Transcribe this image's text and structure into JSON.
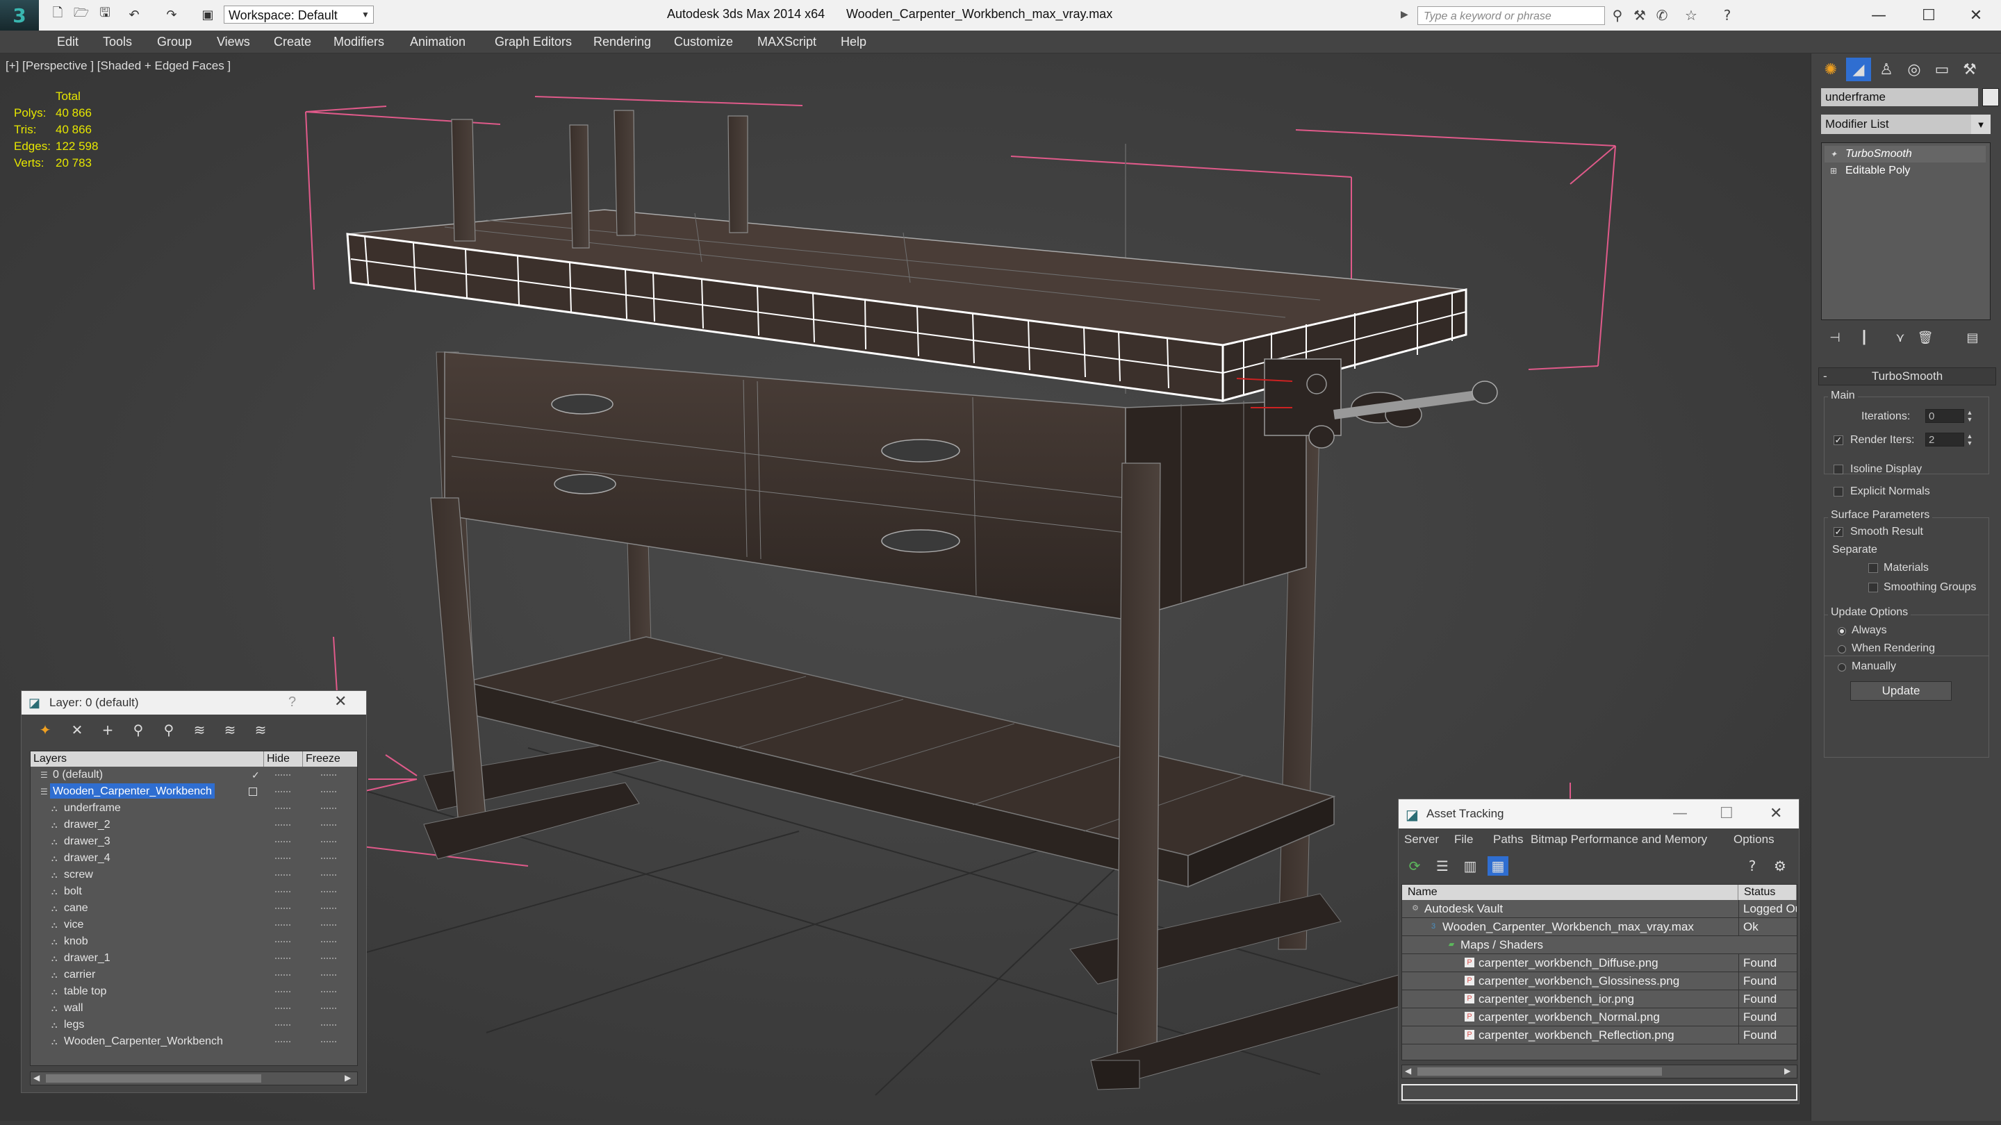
{
  "titlebar": {
    "workspace": "Workspace: Default",
    "app_title": "Autodesk 3ds Max 2014 x64",
    "file_title": "Wooden_Carpenter_Workbench_max_vray.max",
    "search_placeholder": "Type a keyword or phrase"
  },
  "menu": [
    "Edit",
    "Tools",
    "Group",
    "Views",
    "Create",
    "Modifiers",
    "Animation",
    "Graph Editors",
    "Rendering",
    "Customize",
    "MAXScript",
    "Help"
  ],
  "viewport": {
    "label": "[+] [Perspective ] [Shaded + Edged Faces ]",
    "stats": {
      "header": "Total",
      "rows": [
        {
          "label": "Polys:",
          "value": "40 866"
        },
        {
          "label": "Tris:",
          "value": "40 866"
        },
        {
          "label": "Edges:",
          "value": "122 598"
        },
        {
          "label": "Verts:",
          "value": "20 783"
        }
      ]
    }
  },
  "command_panel": {
    "object_name": "underframe",
    "modifier_list": "Modifier List",
    "stack": [
      "TurboSmooth",
      "Editable Poly"
    ],
    "rollout_title": "TurboSmooth",
    "main": {
      "title": "Main",
      "iterations_label": "Iterations:",
      "iterations_value": "0",
      "render_iters_label": "Render Iters:",
      "render_iters_value": "2",
      "isoline": "Isoline Display",
      "explicit": "Explicit Normals"
    },
    "surface": {
      "title": "Surface Parameters",
      "smooth": "Smooth Result",
      "separate": "Separate",
      "materials": "Materials",
      "smoothing_groups": "Smoothing Groups"
    },
    "update_options": {
      "title": "Update Options",
      "always": "Always",
      "when_rendering": "When Rendering",
      "manually": "Manually",
      "button": "Update"
    }
  },
  "layer_window": {
    "title": "Layer: 0 (default)",
    "help": "?",
    "columns": {
      "layers": "Layers",
      "hide": "Hide",
      "freeze": "Freeze"
    },
    "rows": [
      {
        "name": "0 (default)",
        "level": 1
      },
      {
        "name": "Wooden_Carpenter_Workbench",
        "level": 1
      },
      {
        "name": "underframe",
        "level": 2
      },
      {
        "name": "drawer_2",
        "level": 2
      },
      {
        "name": "drawer_3",
        "level": 2
      },
      {
        "name": "drawer_4",
        "level": 2
      },
      {
        "name": "screw",
        "level": 2
      },
      {
        "name": "bolt",
        "level": 2
      },
      {
        "name": "cane",
        "level": 2
      },
      {
        "name": "vice",
        "level": 2
      },
      {
        "name": "knob",
        "level": 2
      },
      {
        "name": "drawer_1",
        "level": 2
      },
      {
        "name": "carrier",
        "level": 2
      },
      {
        "name": "table top",
        "level": 2
      },
      {
        "name": "wall",
        "level": 2
      },
      {
        "name": "legs",
        "level": 2
      },
      {
        "name": "Wooden_Carpenter_Workbench",
        "level": 2
      }
    ]
  },
  "asset_window": {
    "title": "Asset Tracking",
    "menu": [
      "Server",
      "File",
      "Paths",
      "Bitmap Performance and Memory",
      "Options"
    ],
    "columns": {
      "name": "Name",
      "status": "Status"
    },
    "rows": [
      {
        "name": "Autodesk Vault",
        "status": "Logged Out",
        "indent": 0
      },
      {
        "name": "Wooden_Carpenter_Workbench_max_vray.max",
        "status": "Ok",
        "indent": 1
      },
      {
        "name": "Maps / Shaders",
        "status": "",
        "indent": 2
      },
      {
        "name": "carpenter_workbench_Diffuse.png",
        "status": "Found",
        "indent": 3
      },
      {
        "name": "carpenter_workbench_Glossiness.png",
        "status": "Found",
        "indent": 3
      },
      {
        "name": "carpenter_workbench_ior.png",
        "status": "Found",
        "indent": 3
      },
      {
        "name": "carpenter_workbench_Normal.png",
        "status": "Found",
        "indent": 3
      },
      {
        "name": "carpenter_workbench_Reflection.png",
        "status": "Found",
        "indent": 3
      }
    ]
  },
  "colors": {
    "accent": "#2f6ed1",
    "stats_text": "#e6e600",
    "bbox_pink": "#e05a8a"
  }
}
